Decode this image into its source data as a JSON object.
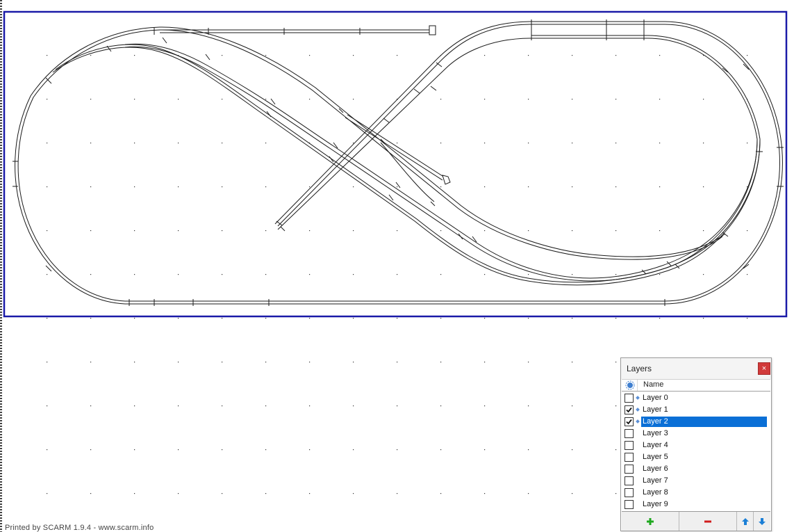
{
  "footer": {
    "printed_by": "Printed by SCARM 1.9.4 - www.scarm.info"
  },
  "layers_panel": {
    "title": "Layers",
    "close_label": "×",
    "column_name": "Name",
    "layers": [
      {
        "name": "Layer 0",
        "checked": false,
        "has_content": true,
        "selected": false
      },
      {
        "name": "Layer 1",
        "checked": true,
        "has_content": true,
        "selected": false
      },
      {
        "name": "Layer 2",
        "checked": true,
        "has_content": true,
        "selected": true
      },
      {
        "name": "Layer 3",
        "checked": false,
        "has_content": false,
        "selected": false
      },
      {
        "name": "Layer 4",
        "checked": false,
        "has_content": false,
        "selected": false
      },
      {
        "name": "Layer 5",
        "checked": false,
        "has_content": false,
        "selected": false
      },
      {
        "name": "Layer 6",
        "checked": false,
        "has_content": false,
        "selected": false
      },
      {
        "name": "Layer 7",
        "checked": false,
        "has_content": false,
        "selected": false
      },
      {
        "name": "Layer 8",
        "checked": false,
        "has_content": false,
        "selected": false
      },
      {
        "name": "Layer 9",
        "checked": false,
        "has_content": false,
        "selected": false
      }
    ],
    "toolbar": {
      "add_icon": "plus-icon",
      "remove_icon": "minus-icon",
      "up_icon": "arrow-up-icon",
      "down_icon": "arrow-down-icon"
    }
  },
  "colors": {
    "board_border": "#1a1aa8",
    "track": "#1a1a1a",
    "selection": "#0a6fd6",
    "add": "#1fa81f",
    "remove": "#d01c1c",
    "arrows": "#1b7fd6"
  }
}
